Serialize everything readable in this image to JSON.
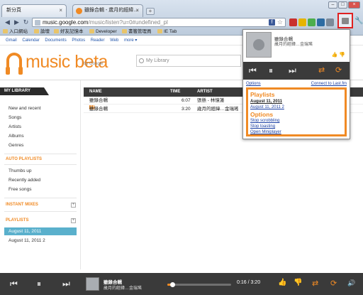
{
  "browser": {
    "tabs": [
      {
        "label": "新分頁"
      },
      {
        "label": "雖錄合輯 - 歲月的經緯…"
      }
    ],
    "url_host": "music.google.com",
    "url_path": "/music/listen?u=0#undefined_pl",
    "bookmarks": [
      "入口網站",
      "論壇",
      "好友記憶本",
      "Developer",
      "書籤管理員",
      "IE Tab"
    ]
  },
  "google_bar": {
    "links": [
      "Gmail",
      "Calendar",
      "Documents",
      "Photos",
      "Reader",
      "Web",
      "more ▾"
    ]
  },
  "logo": {
    "text": "music beta",
    "by": "by Google"
  },
  "search": {
    "placeholder": "My Library"
  },
  "sidebar": {
    "header": "MY LIBRARY",
    "items": [
      "New and recent",
      "Songs",
      "Artists",
      "Albums",
      "Genres"
    ],
    "auto_header": "AUTO PLAYLISTS",
    "auto_items": [
      "Thumbs up",
      "Recently added",
      "Free songs"
    ],
    "instant_header": "INSTANT MIXES",
    "playlists_header": "PLAYLISTS",
    "playlists": [
      "August 11, 2011",
      "August 11, 2011 2"
    ]
  },
  "table": {
    "columns": [
      "NAME",
      "TIME",
      "ARTIST"
    ],
    "rows": [
      {
        "name": "雖錄合輯",
        "time": "6:07",
        "artist": "張懸 - 林憶蓮"
      },
      {
        "name": "雖錄合輯",
        "time": "3:20",
        "artist": "歲月的經緯…金瑞瑤"
      }
    ]
  },
  "popup": {
    "title": "雖錄合輯",
    "artist": "歲月的經緯…金瑞瑤",
    "options_link": "Options",
    "lastfm_link": "Connect to Last.fm",
    "playlists_header": "Playlists",
    "playlists": [
      "August 11, 2011",
      "August 11, 2011 2"
    ],
    "options_header": "Options",
    "options": [
      "Stop scrobbling",
      "Stop toasting",
      "Open Miniplayer"
    ]
  },
  "player": {
    "title": "雖錄合輯",
    "artist": "歲月的經緯…金瑞瑤",
    "time": "0:16 / 3:20",
    "progress": 0.08
  },
  "colors": {
    "accent": "#f08a24",
    "dark": "#3a3a3a",
    "selected": "#5ab0cc"
  },
  "icons": {
    "prev": "skip-previous-icon",
    "pause": "pause-icon",
    "next": "skip-next-icon",
    "shuffle": "shuffle-icon",
    "repeat": "repeat-icon",
    "thumbs_up": "thumbs-up-icon",
    "thumbs_down": "thumbs-down-icon",
    "volume": "volume-icon"
  }
}
